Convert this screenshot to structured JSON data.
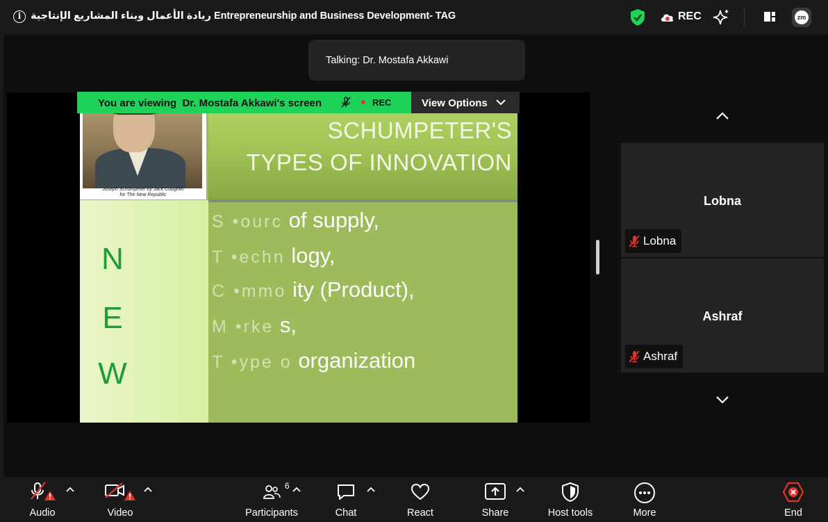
{
  "titlebar": {
    "title": "ريادة الأعمال وبناء المشاريع الإنتاجية Entrepreneurship and Business Development- TAG",
    "info_glyph": "i",
    "rec_label": "REC",
    "zoom_badge": "zm",
    "icons": [
      "info-icon",
      "encryption-shield-icon",
      "recording-cloud-icon",
      "ai-sparkle-icon",
      "layout-icon",
      "zoom-app-icon"
    ]
  },
  "talking": {
    "text": "Talking: Dr. Mostafa Akkawi"
  },
  "viewing_bar": {
    "prefix": "You are viewing",
    "presenter": "Dr. Mostafa Akkawi's screen",
    "rec": "REC",
    "view_options": "View Options",
    "accent": "#1fd35a"
  },
  "slide": {
    "title_line1": "SCHUMPETER'S",
    "title_line2": "TYPES OF INNOVATION",
    "caption_line1": "Joseph Schumpeter by Jack Coughlin",
    "caption_line2": "for The New Republic",
    "new_letters": [
      "N",
      "E",
      "W"
    ],
    "lines": [
      {
        "ghost": "S •ourc",
        "text": "of supply,"
      },
      {
        "ghost": "T •echn",
        "text": "logy,"
      },
      {
        "ghost": "C •mmo",
        "text": "ity (Product),"
      },
      {
        "ghost": "M •rke",
        "text": "s,"
      },
      {
        "ghost": "T •ype o",
        "text": "organization"
      }
    ]
  },
  "participants_panel": {
    "tiles": [
      {
        "name": "Lobna",
        "label": "Lobna",
        "muted": true
      },
      {
        "name": "Ashraf",
        "label": "Ashraf",
        "muted": true
      }
    ]
  },
  "toolbar": {
    "audio": "Audio",
    "video": "Video",
    "participants": "Participants",
    "participants_count": "6",
    "chat": "Chat",
    "react": "React",
    "share": "Share",
    "host_tools": "Host tools",
    "more": "More",
    "end": "End",
    "end_color": "#e5322d",
    "warning_color": "#e5322d"
  }
}
